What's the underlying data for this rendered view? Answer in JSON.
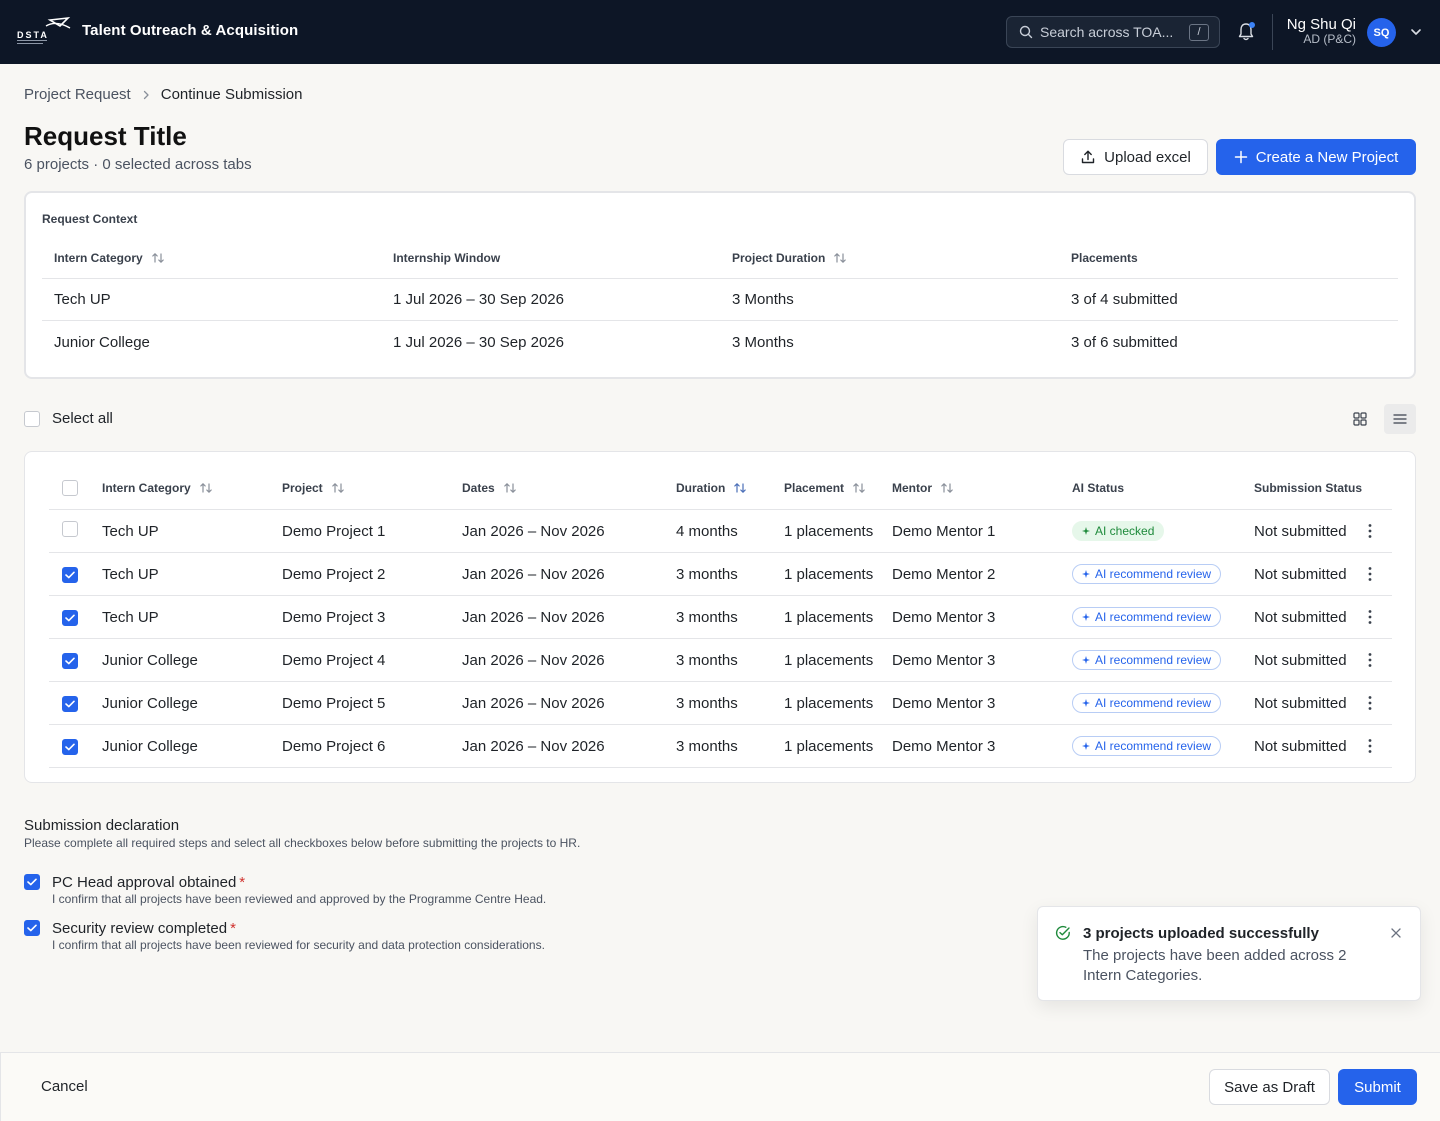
{
  "header": {
    "logo_text": "DSTA",
    "app_title": "Talent Outreach & Acquisition",
    "search_placeholder": "Search across TOA...",
    "search_shortcut": "/",
    "user_name": "Ng Shu Qi",
    "user_role": "AD (P&C)",
    "avatar_initials": "SQ"
  },
  "breadcrumb": {
    "parent": "Project Request",
    "current": "Continue Submission"
  },
  "page": {
    "title": "Request Title",
    "subtitle": "6 projects · 0 selected across tabs",
    "upload_label": "Upload excel",
    "create_label": "Create a New Project"
  },
  "context": {
    "label": "Request Context",
    "columns": [
      "Intern Category",
      "Internship Window",
      "Project Duration",
      "Placements"
    ],
    "rows": [
      [
        "Tech UP",
        "1 Jul 2026 – 30 Sep 2026",
        "3 Months",
        "3 of 4 submitted"
      ],
      [
        "Junior College",
        "1 Jul 2026 – 30 Sep 2026",
        "3 Months",
        "3 of 6 submitted"
      ]
    ]
  },
  "select_all_label": "Select all",
  "projects": {
    "columns": [
      "Intern Category",
      "Project",
      "Dates",
      "Duration",
      "Placement",
      "Mentor",
      "AI Status",
      "Submission Status"
    ],
    "rows": [
      {
        "checked": false,
        "category": "Tech UP",
        "project": "Demo Project 1",
        "dates": "Jan 2026 – Nov 2026",
        "duration": "4 months",
        "placement": "1 placements",
        "mentor": "Demo Mentor 1",
        "ai_status": "AI checked",
        "ai_type": "green",
        "submission": "Not submitted"
      },
      {
        "checked": true,
        "category": "Tech UP",
        "project": "Demo Project 2",
        "dates": "Jan 2026 – Nov 2026",
        "duration": "3 months",
        "placement": "1 placements",
        "mentor": "Demo Mentor 2",
        "ai_status": "AI recommend review",
        "ai_type": "blue",
        "submission": "Not submitted"
      },
      {
        "checked": true,
        "category": "Tech UP",
        "project": "Demo Project 3",
        "dates": "Jan 2026 – Nov 2026",
        "duration": "3 months",
        "placement": "1 placements",
        "mentor": "Demo Mentor 3",
        "ai_status": "AI recommend review",
        "ai_type": "blue",
        "submission": "Not submitted"
      },
      {
        "checked": true,
        "category": "Junior College",
        "project": "Demo Project 4",
        "dates": "Jan 2026 – Nov 2026",
        "duration": "3 months",
        "placement": "1 placements",
        "mentor": "Demo Mentor 3",
        "ai_status": "AI recommend review",
        "ai_type": "blue",
        "submission": "Not submitted"
      },
      {
        "checked": true,
        "category": "Junior College",
        "project": "Demo Project 5",
        "dates": "Jan 2026 – Nov 2026",
        "duration": "3 months",
        "placement": "1 placements",
        "mentor": "Demo Mentor 3",
        "ai_status": "AI recommend review",
        "ai_type": "blue",
        "submission": "Not submitted"
      },
      {
        "checked": true,
        "category": "Junior College",
        "project": "Demo Project 6",
        "dates": "Jan 2026 – Nov 2026",
        "duration": "3 months",
        "placement": "1 placements",
        "mentor": "Demo Mentor 3",
        "ai_status": "AI recommend review",
        "ai_type": "blue",
        "submission": "Not submitted"
      }
    ]
  },
  "declaration": {
    "title": "Submission declaration",
    "subtitle": "Please complete all required steps and select all checkboxes below before submitting the projects to HR.",
    "items": [
      {
        "checked": true,
        "label": "PC Head approval obtained",
        "required": "*",
        "desc": "I confirm that all projects have been reviewed and approved by the Programme Centre Head."
      },
      {
        "checked": true,
        "label": "Security review completed",
        "required": "*",
        "desc": "I confirm that all projects have been reviewed for security and data protection considerations."
      }
    ]
  },
  "toast": {
    "title": "3 projects uploaded successfully",
    "body": "The projects have been added across 2 Intern Categories."
  },
  "footer": {
    "cancel_label": "Cancel",
    "draft_label": "Save as Draft",
    "submit_label": "Submit"
  },
  "colors": {
    "accent": "#2563eb",
    "topbar": "#0d1626",
    "success": "#1e8a3b"
  }
}
